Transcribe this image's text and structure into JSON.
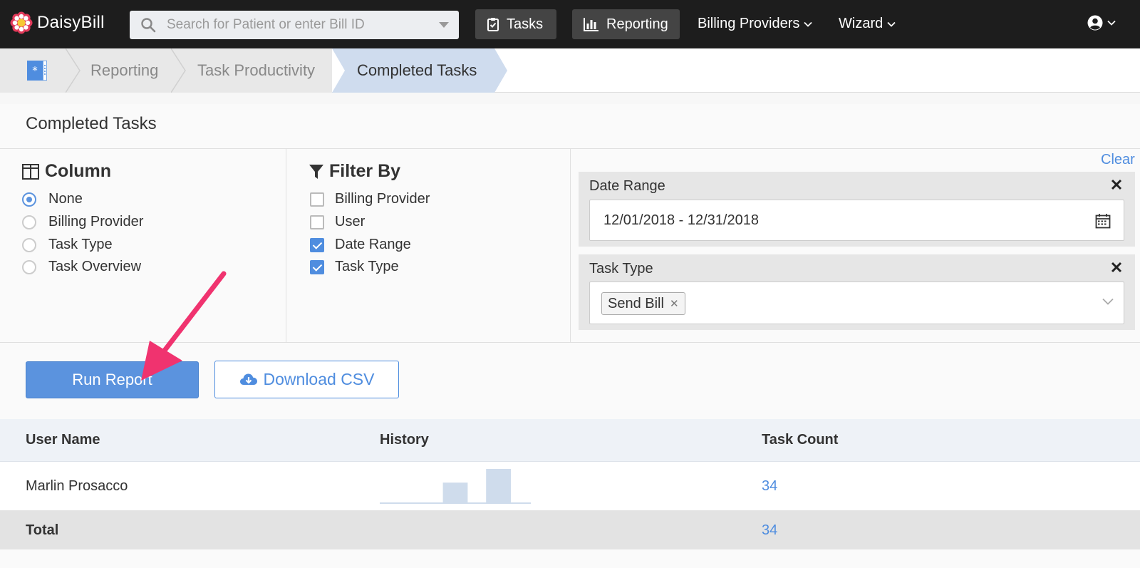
{
  "app": {
    "name": "DaisyBill"
  },
  "topnav": {
    "search_placeholder": "Search for Patient or enter Bill ID",
    "tasks_label": "Tasks",
    "reporting_label": "Reporting",
    "billing_providers_label": "Billing Providers",
    "wizard_label": "Wizard"
  },
  "breadcrumb": {
    "items": [
      "Reporting",
      "Task Productivity"
    ],
    "active": "Completed Tasks"
  },
  "panel": {
    "title": "Completed Tasks"
  },
  "column": {
    "heading": "Column",
    "options": [
      {
        "label": "None",
        "selected": true
      },
      {
        "label": "Billing Provider",
        "selected": false
      },
      {
        "label": "Task Type",
        "selected": false
      },
      {
        "label": "Task Overview",
        "selected": false
      }
    ]
  },
  "filter_by": {
    "heading": "Filter By",
    "options": [
      {
        "label": "Billing Provider",
        "checked": false
      },
      {
        "label": "User",
        "checked": false
      },
      {
        "label": "Date Range",
        "checked": true
      },
      {
        "label": "Task Type",
        "checked": true
      }
    ]
  },
  "filters": {
    "clear_label": "Clear",
    "date_range": {
      "label": "Date Range",
      "value": "12/01/2018 - 12/31/2018"
    },
    "task_type": {
      "label": "Task Type",
      "tags": [
        "Send Bill"
      ]
    }
  },
  "actions": {
    "run_report": "Run Report",
    "download_csv": "Download CSV"
  },
  "table": {
    "headers": [
      "User Name",
      "History",
      "Task Count"
    ],
    "rows": [
      {
        "user": "Marlin Prosacco",
        "task_count": "34",
        "history": [
          0,
          0,
          0,
          0.6,
          0,
          1,
          0
        ]
      }
    ],
    "total_label": "Total",
    "total_count": "34"
  },
  "colors": {
    "accent": "#4f8ddf",
    "nav_bg": "#1d1d1d",
    "annotation_arrow": "#f0336f",
    "sparkline": "#cfdcec"
  },
  "icons": {
    "logo": "daisy-flower-icon",
    "search": "search-icon",
    "tasks": "clipboard-check-icon",
    "reporting": "bar-chart-icon",
    "user": "user-circle-icon",
    "column": "columns-icon",
    "filter": "funnel-icon",
    "calendar": "calendar-icon",
    "download": "cloud-download-icon"
  }
}
